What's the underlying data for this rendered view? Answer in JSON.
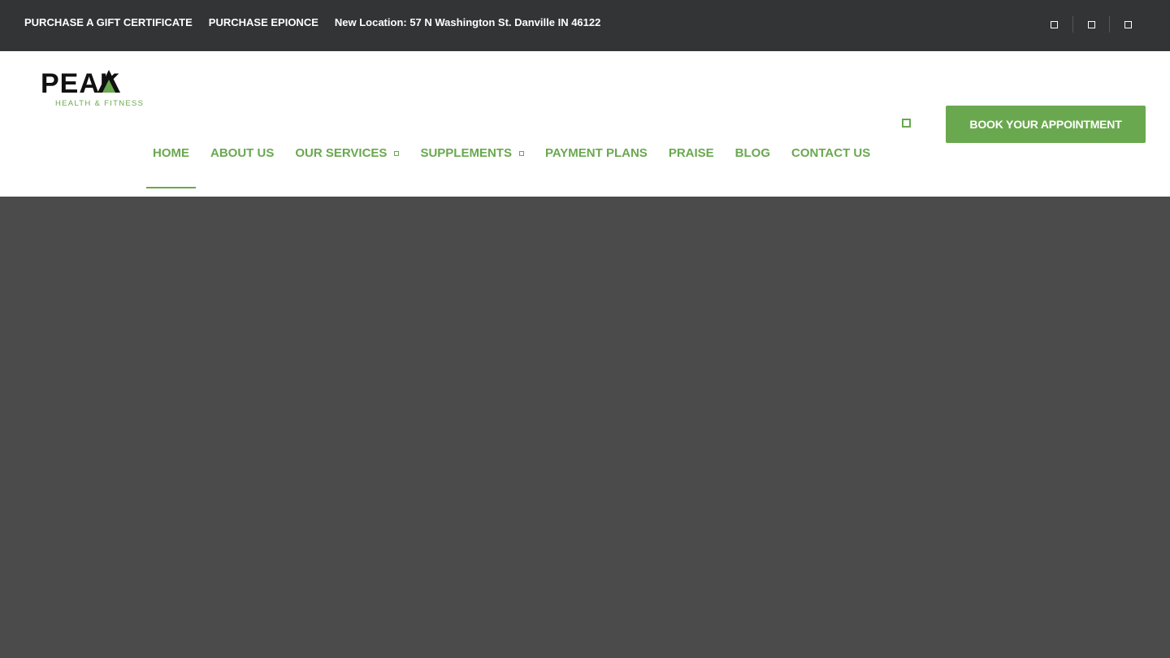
{
  "topbar": {
    "links": [
      "PURCHASE A GIFT CERTIFICATE",
      "PURCHASE EPIONCE"
    ],
    "location": "New Location: 57 N Washington St. Danville IN 46122",
    "social_icons": [
      "facebook-icon",
      "instagram-icon",
      "youtube-icon"
    ]
  },
  "logo": {
    "name": "PEAK",
    "tagline": "HEALTH & FITNESS"
  },
  "nav": {
    "items": [
      {
        "label": "HOME",
        "active": true,
        "dropdown": false
      },
      {
        "label": "ABOUT US",
        "active": false,
        "dropdown": false
      },
      {
        "label": "OUR SERVICES",
        "active": false,
        "dropdown": true
      },
      {
        "label": "SUPPLEMENTS",
        "active": false,
        "dropdown": true
      },
      {
        "label": "PAYMENT PLANS",
        "active": false,
        "dropdown": false
      },
      {
        "label": "PRAISE",
        "active": false,
        "dropdown": false
      },
      {
        "label": "BLOG",
        "active": false,
        "dropdown": false
      },
      {
        "label": "CONTACT US",
        "active": false,
        "dropdown": false
      }
    ]
  },
  "header": {
    "search_icon": "search-icon",
    "book_label": "BOOK YOUR APPOINTMENT"
  },
  "colors": {
    "topbar_bg": "#333436",
    "accent_green": "#6aa84f",
    "hero_bg": "#4b4b4b",
    "header_bg": "#ffffff"
  }
}
